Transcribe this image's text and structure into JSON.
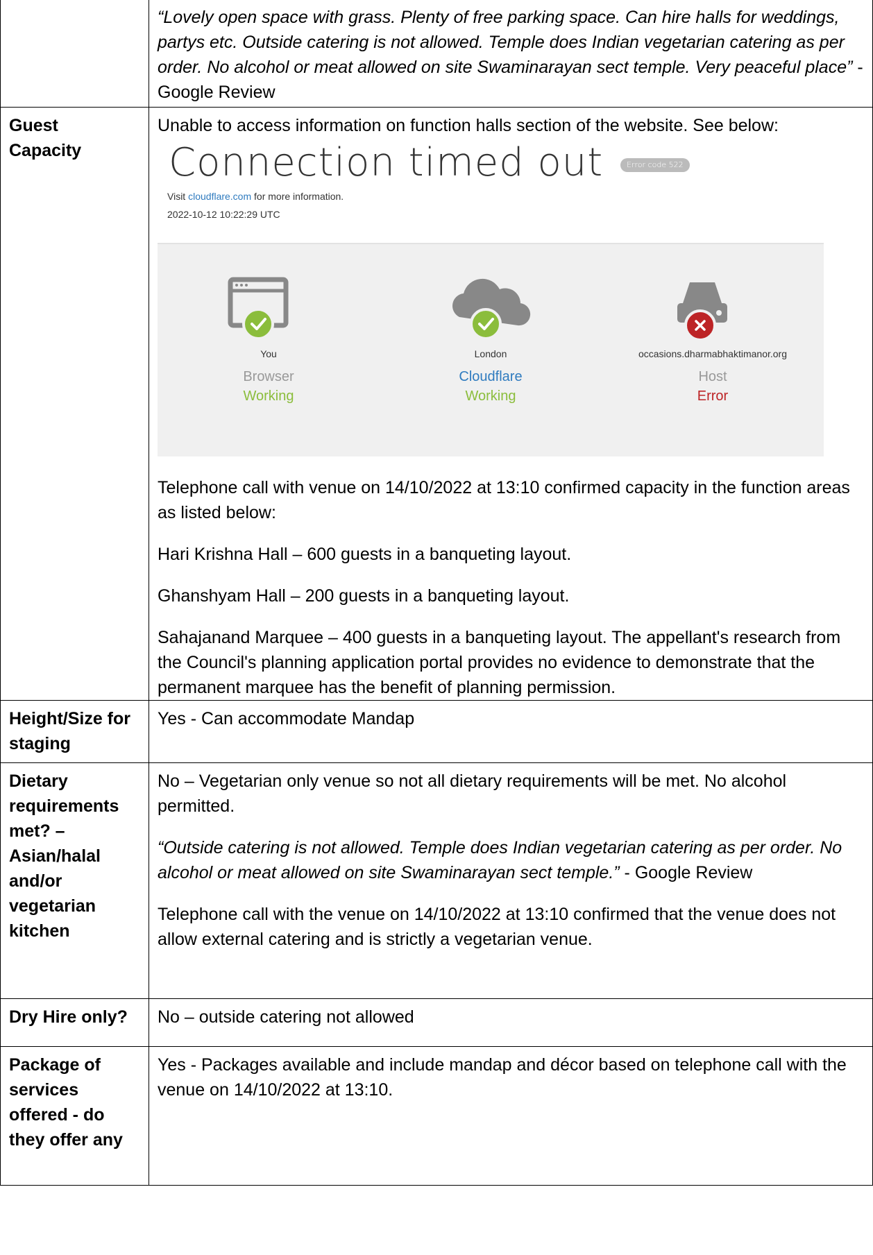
{
  "rows": [
    {
      "label": "",
      "review_quote": "“Lovely open space with grass. Plenty of free parking space. Can hire halls for weddings, partys etc. Outside catering is not allowed. Temple does Indian vegetarian catering as per order. No alcohol or meat allowed on site Swaminarayan sect temple. Very peaceful place”",
      "review_source": " - Google Review"
    },
    {
      "label_line1": "Guest",
      "label_line2": "Capacity",
      "intro": "Unable to access information on function halls section of the website. See below:",
      "error_screenshot": {
        "title": "Connection timed out",
        "error_code": "Error code 522",
        "visit_prefix": "Visit ",
        "visit_link": "cloudflare.com",
        "visit_suffix": " for more information.",
        "timestamp": "2022-10-12 10:22:29 UTC",
        "nodes": [
          {
            "location": "You",
            "kind": "Browser",
            "status": "Working",
            "icon": "browser-icon",
            "ok": true
          },
          {
            "location": "London",
            "kind": "Cloudflare",
            "status": "Working",
            "icon": "cloud-icon",
            "ok": true
          },
          {
            "location": "occasions.dharmabhaktimanor.org",
            "kind": "Host",
            "status": "Error",
            "icon": "server-icon",
            "ok": false
          }
        ],
        "colors": {
          "ok": "#8bbd3c",
          "error": "#bd2426",
          "link": "#2f7bbf"
        }
      },
      "call_note": "Telephone call with venue on 14/10/2022 at 13:10 confirmed capacity in the function areas as listed below:",
      "hall_1": "Hari Krishna Hall – 600 guests in a banqueting layout.",
      "hall_2": "Ghanshyam Hall – 200 guests in a banqueting layout.",
      "hall_3": "Sahajanand Marquee – 400 guests in a banqueting layout. The appellant's research from the Council's planning application portal provides no evidence to demonstrate that the permanent marquee has the benefit of planning permission."
    },
    {
      "label": "Height/Size for staging",
      "value": "Yes - Can accommodate Mandap"
    },
    {
      "label": "Dietary requirements met? – Asian/halal and/or vegetarian kitchen",
      "value": "No – Vegetarian only venue so not all dietary requirements will be met. No alcohol permitted.",
      "review_quote": "“Outside catering is not allowed. Temple does Indian vegetarian catering as per order. No alcohol or meat allowed on site Swaminarayan sect temple.”",
      "review_source": " - Google Review",
      "call_note": "Telephone call with the venue on 14/10/2022 at 13:10 confirmed that the venue does not allow external catering and is strictly a vegetarian venue."
    },
    {
      "label": "Dry Hire only?",
      "value": "No – outside catering not allowed"
    },
    {
      "label": "Package of services offered - do they offer any",
      "value": "Yes - Packages available and include mandap and décor based on telephone call with the venue on 14/10/2022 at 13:10."
    }
  ]
}
